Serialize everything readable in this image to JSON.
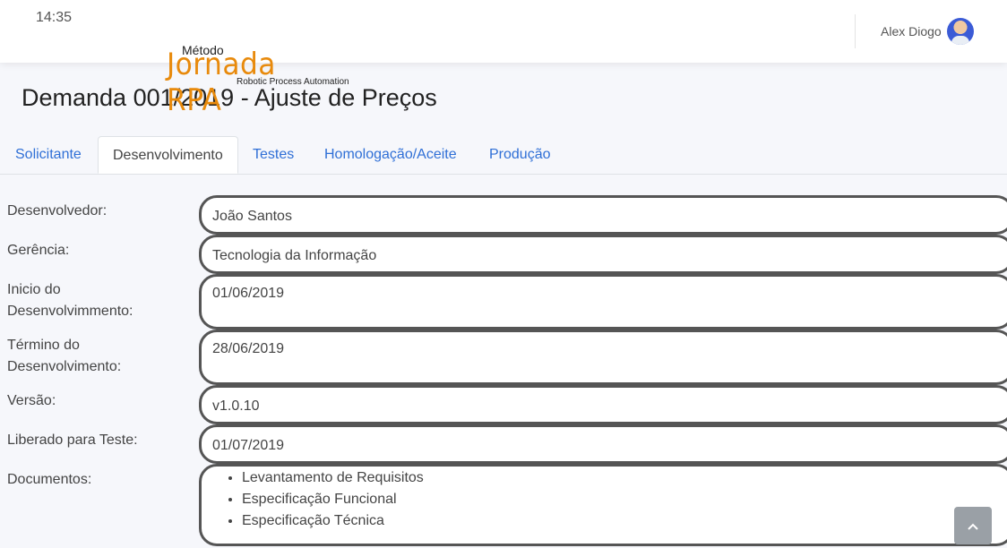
{
  "topbar": {
    "time": "14:35",
    "user_name": "Alex Diogo"
  },
  "logo": {
    "line1": "Método",
    "brand": "Jornada RPA",
    "tagline": "Robotic Process Automation"
  },
  "page_title": "Demanda 001/2019 - Ajuste de Preços",
  "tabs": [
    {
      "label": "Solicitante"
    },
    {
      "label": "Desenvolvimento",
      "active": true
    },
    {
      "label": "Testes"
    },
    {
      "label": "Homologação/Aceite"
    },
    {
      "label": "Produção"
    }
  ],
  "form": {
    "developer": {
      "label": "Desenvolvedor:",
      "value": "João Santos"
    },
    "management": {
      "label": "Gerência:",
      "value": "Tecnologia da Informação"
    },
    "start": {
      "label": "Inicio do Desenvolvimmento:",
      "value": "01/06/2019"
    },
    "end": {
      "label": "Término do Desenvolvimento:",
      "value": "28/06/2019"
    },
    "version": {
      "label": "Versão:",
      "value": "v1.0.10"
    },
    "released": {
      "label": "Liberado para Teste:",
      "value": "01/07/2019"
    },
    "documents": {
      "label": "Documentos:",
      "items": [
        "Levantamento de Requisitos",
        "Especificação Funcional",
        "Especificação Técnica"
      ]
    }
  },
  "icons": {
    "scroll_top": "chevron-up-icon"
  }
}
